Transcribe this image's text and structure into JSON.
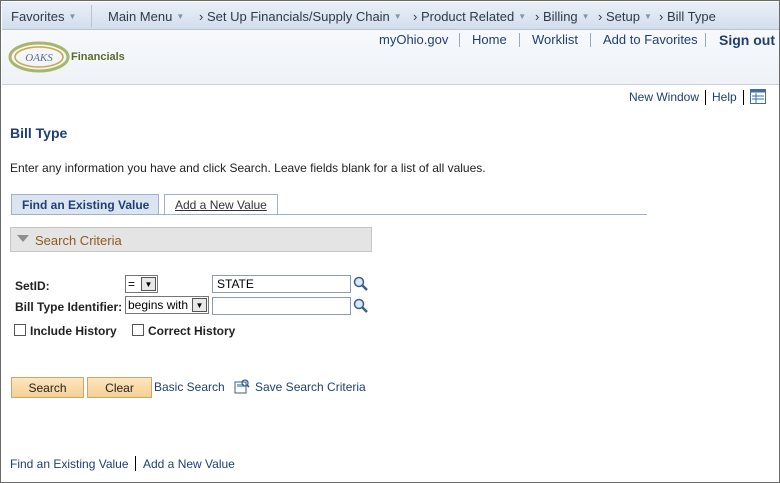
{
  "nav": {
    "favorites": "Favorites",
    "main_menu": "Main Menu",
    "breadcrumb": [
      "Set Up Financials/Supply Chain",
      "Product Related",
      "Billing",
      "Setup",
      "Bill Type"
    ]
  },
  "header": {
    "logo_text": "OAKS",
    "logo_caption": "Financials",
    "links": [
      "myOhio.gov",
      "Home",
      "Worklist",
      "Add to Favorites"
    ],
    "signout": "Sign out"
  },
  "pagebar": {
    "new_window": "New Window",
    "help": "Help"
  },
  "page": {
    "title": "Bill Type",
    "instructions": "Enter any information you have and click Search. Leave fields blank for a list of all values."
  },
  "tabs": {
    "find": "Find an Existing Value",
    "add": "Add a New Value"
  },
  "criteria": {
    "title": "Search Criteria",
    "setid_label": "SetID:",
    "setid_operator": "=",
    "setid_value": "STATE",
    "billtype_label": "Bill Type Identifier:",
    "billtype_operator": "begins with",
    "billtype_value": "",
    "include_history": "Include History",
    "correct_history": "Correct History"
  },
  "actions": {
    "search": "Search",
    "clear": "Clear",
    "basic_search": "Basic Search",
    "save_search": "Save Search Criteria"
  },
  "footer": {
    "find": "Find an Existing Value",
    "add": "Add a New Value"
  }
}
